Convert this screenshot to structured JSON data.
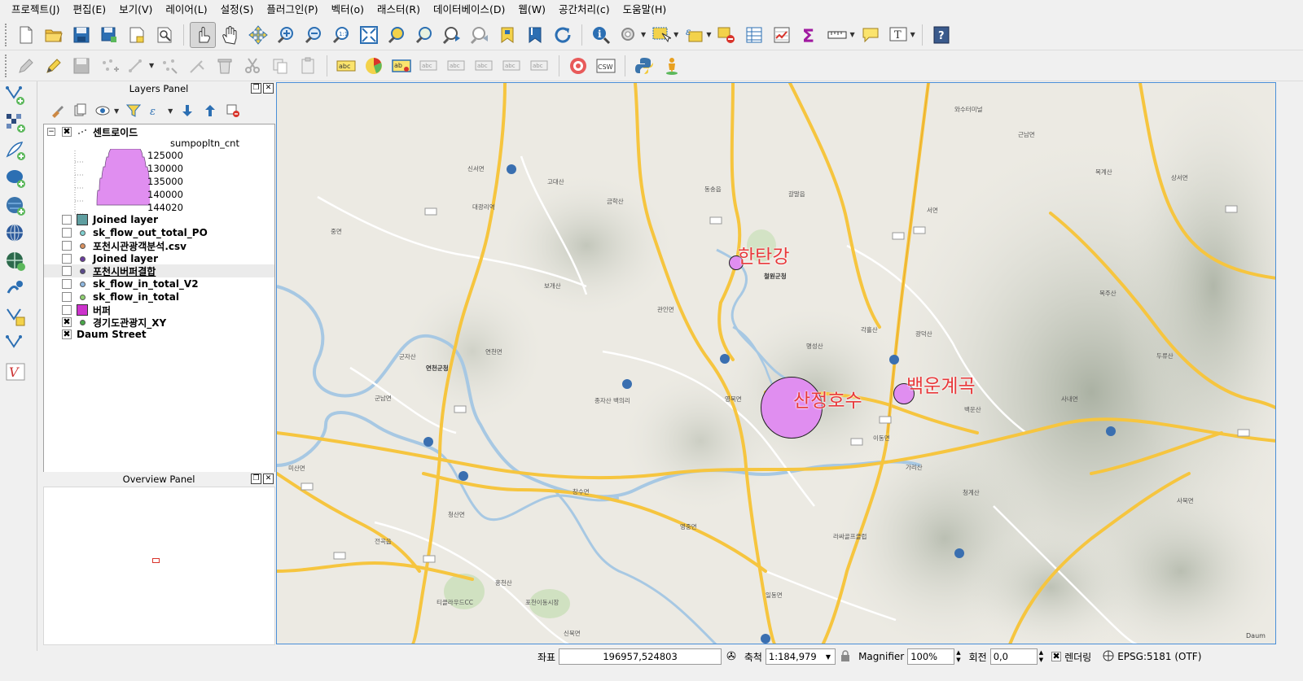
{
  "menu": [
    "프로젝트(J)",
    "편집(E)",
    "보기(V)",
    "레이어(L)",
    "설정(S)",
    "플러그인(P)",
    "벡터(o)",
    "래스터(R)",
    "데이터베이스(D)",
    "웹(W)",
    "공간처리(c)",
    "도움말(H)"
  ],
  "toolbar1_icons": [
    "new-project-icon",
    "open-project-icon",
    "save-project-icon",
    "save-as-icon",
    "new-print-composer-icon",
    "composer-manager-icon",
    "pan-touch-icon",
    "pan-icon",
    "pan-to-selection-icon",
    "zoom-in-icon",
    "zoom-out-icon",
    "zoom-actual-icon",
    "zoom-full-icon",
    "zoom-to-selection-icon",
    "zoom-to-layer-icon",
    "zoom-last-icon",
    "zoom-next-icon",
    "new-bookmark-icon",
    "show-bookmarks-icon",
    "refresh-icon",
    "identify-icon",
    "action-icon",
    "select-icon",
    "select-expression-icon",
    "deselect-icon",
    "attribute-table-icon",
    "field-calculator-icon",
    "statistics-icon",
    "measure-icon",
    "annotation-icon",
    "text-annotation-icon",
    "help-icon"
  ],
  "toolbar2_icons": [
    "current-edits-icon",
    "toggle-editing-icon",
    "save-edits-icon",
    "add-feature-icon",
    "move-feature-icon",
    "node-tool-icon",
    "delete-selected-icon",
    "cut-features-icon",
    "copy-features-icon",
    "paste-features-icon",
    "label-icon",
    "diagram-icon",
    "pin-labels-icon",
    "show-hide-labels-icon",
    "move-label-icon",
    "rotate-label-icon",
    "change-label-icon",
    "label-toolbar-icon",
    "metasearch-icon",
    "csw-icon",
    "python-console-icon",
    "street-view-icon"
  ],
  "leftbar_icons": [
    "add-vector-layer-icon",
    "add-raster-layer-icon",
    "add-delimited-text-icon",
    "add-postgis-layer-icon",
    "add-spatialite-layer-icon",
    "add-wms-layer-icon",
    "add-wcs-layer-icon",
    "add-wfs-layer-icon",
    "new-shapefile-icon",
    "new-spatialite-icon",
    "new-gpx-icon",
    "georeferencer-icon"
  ],
  "layers_panel": {
    "title": "Layers Panel",
    "legend_field": "sumpopltn_cnt",
    "legend_values": [
      "125000",
      "130000",
      "135000",
      "140000",
      "144020"
    ],
    "layers": [
      {
        "name": "센트로이드",
        "checked": true,
        "sym": "group"
      },
      {
        "name": "Joined layer",
        "checked": false,
        "sym": "square",
        "color": "#5f9ea0"
      },
      {
        "name": "sk_flow_out_total_PO",
        "checked": false,
        "sym": "dot",
        "color": "#7fd0d0"
      },
      {
        "name": "포천시관광객분석.csv",
        "checked": false,
        "sym": "dot",
        "color": "#d9905f"
      },
      {
        "name": "Joined layer",
        "checked": false,
        "sym": "dot",
        "color": "#6a3c9e"
      },
      {
        "name": "포천시버퍼결합",
        "checked": false,
        "sym": "dot",
        "color": "#5a4a8a"
      },
      {
        "name": "sk_flow_in_total_V2",
        "checked": false,
        "sym": "dot",
        "color": "#8fb8e0"
      },
      {
        "name": "sk_flow_in_total",
        "checked": false,
        "sym": "dot",
        "color": "#8fd070"
      },
      {
        "name": "버퍼",
        "checked": false,
        "sym": "square",
        "color": "#cc33cc"
      },
      {
        "name": "경기도관광지_XY",
        "checked": true,
        "sym": "dot",
        "color": "#48a848"
      },
      {
        "name": "Daum Street",
        "checked": true,
        "sym": "none"
      }
    ]
  },
  "overview_panel": {
    "title": "Overview Panel"
  },
  "map": {
    "labels": [
      {
        "text": "한탄강"
      },
      {
        "text": "산정호수"
      },
      {
        "text": "백운계곡"
      }
    ],
    "place_names": [
      "신서면",
      "중면",
      "연천군청",
      "연천면",
      "군자산",
      "군남면",
      "미산면",
      "전곡읍",
      "청산면",
      "관인면",
      "보개산",
      "종자산",
      "영북면",
      "창수면",
      "영중면",
      "이동면",
      "가리산",
      "사북면",
      "신북면",
      "일동면",
      "청산면",
      "동송읍",
      "철원군청",
      "갈말읍",
      "서면",
      "근남면",
      "상서면",
      "복계산",
      "복주산",
      "두류산",
      "사내면",
      "광덕산",
      "백운산",
      "명성산",
      "각흘산",
      "와수터미널",
      "산정호수",
      "청계산",
      "라싸골프클럽",
      "티클라우드CC",
      "포천이동시장",
      "홍천산",
      "금학산",
      "고대산",
      "대광리역",
      "백의리"
    ],
    "credit": "Daum"
  },
  "status": {
    "coord_label": "좌표",
    "coord_value": "196957,524803",
    "scale_label": "축척",
    "scale_value": "1:184,979",
    "magnifier_label": "Magnifier",
    "magnifier_value": "100%",
    "rotation_label": "회전",
    "rotation_value": "0,0",
    "render_label": "렌더링",
    "crs": "EPSG:5181 (OTF)"
  }
}
